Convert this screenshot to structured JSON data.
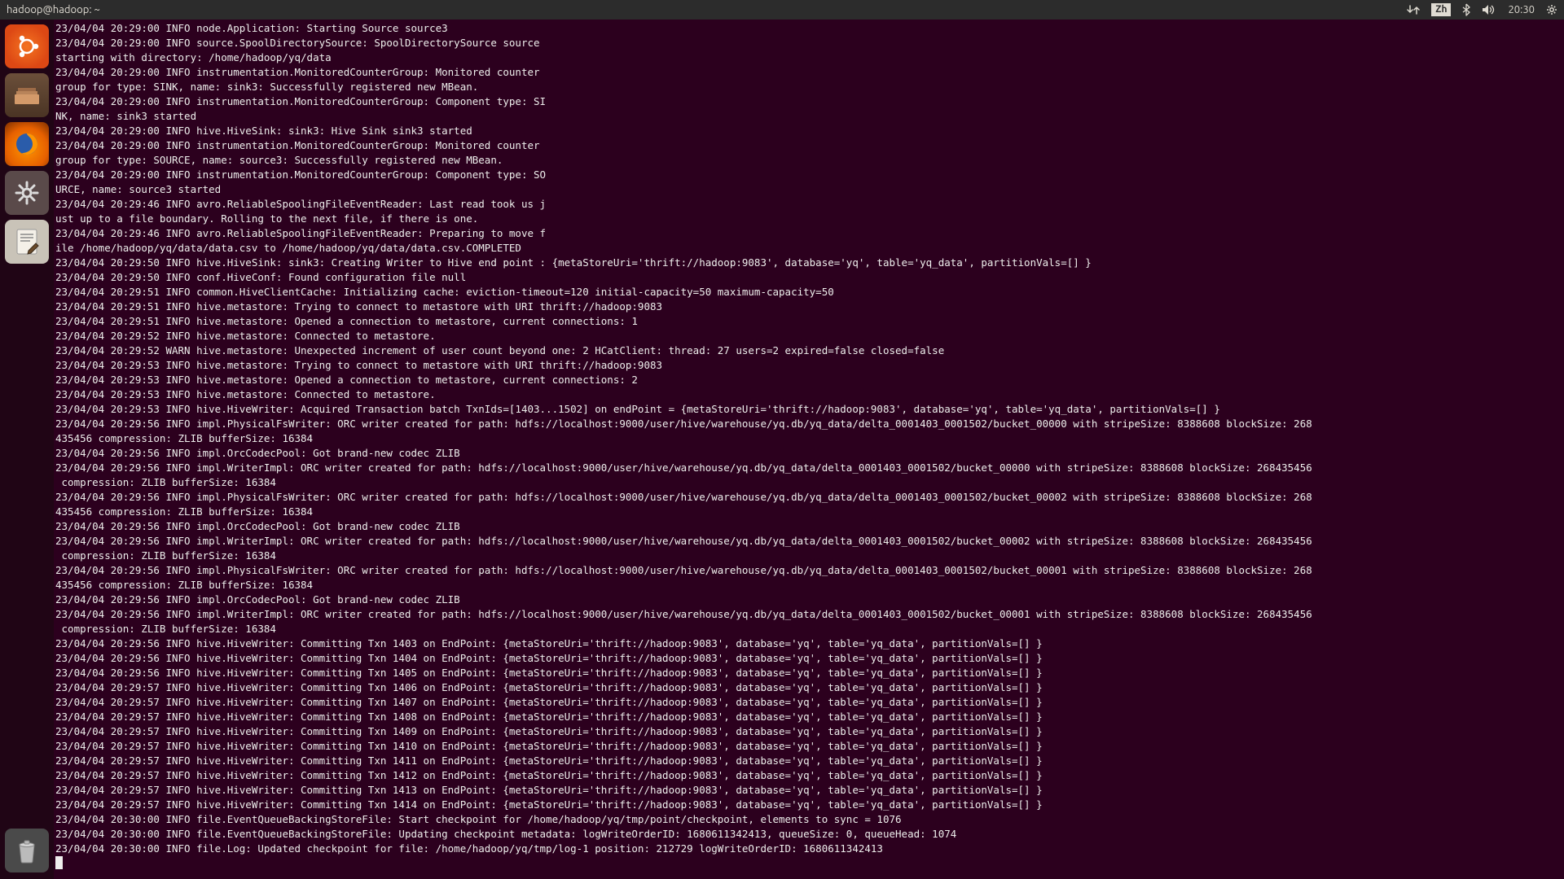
{
  "top_panel": {
    "window_title": "hadoop@hadoop: ~",
    "ime": "Zh",
    "time": "20:30"
  },
  "terminal": {
    "lines": [
      "23/04/04 20:29:00 INFO node.Application: Starting Source source3",
      "23/04/04 20:29:00 INFO source.SpoolDirectorySource: SpoolDirectorySource source",
      "starting with directory: /home/hadoop/yq/data",
      "23/04/04 20:29:00 INFO instrumentation.MonitoredCounterGroup: Monitored counter",
      "group for type: SINK, name: sink3: Successfully registered new MBean.",
      "23/04/04 20:29:00 INFO instrumentation.MonitoredCounterGroup: Component type: SI",
      "NK, name: sink3 started",
      "23/04/04 20:29:00 INFO hive.HiveSink: sink3: Hive Sink sink3 started",
      "23/04/04 20:29:00 INFO instrumentation.MonitoredCounterGroup: Monitored counter",
      "group for type: SOURCE, name: source3: Successfully registered new MBean.",
      "23/04/04 20:29:00 INFO instrumentation.MonitoredCounterGroup: Component type: SO",
      "URCE, name: source3 started",
      "23/04/04 20:29:46 INFO avro.ReliableSpoolingFileEventReader: Last read took us j",
      "ust up to a file boundary. Rolling to the next file, if there is one.",
      "23/04/04 20:29:46 INFO avro.ReliableSpoolingFileEventReader: Preparing to move f",
      "ile /home/hadoop/yq/data/data.csv to /home/hadoop/yq/data/data.csv.COMPLETED",
      "23/04/04 20:29:50 INFO hive.HiveSink: sink3: Creating Writer to Hive end point : {metaStoreUri='thrift://hadoop:9083', database='yq', table='yq_data', partitionVals=[] }",
      "23/04/04 20:29:50 INFO conf.HiveConf: Found configuration file null",
      "23/04/04 20:29:51 INFO common.HiveClientCache: Initializing cache: eviction-timeout=120 initial-capacity=50 maximum-capacity=50",
      "23/04/04 20:29:51 INFO hive.metastore: Trying to connect to metastore with URI thrift://hadoop:9083",
      "23/04/04 20:29:51 INFO hive.metastore: Opened a connection to metastore, current connections: 1",
      "23/04/04 20:29:52 INFO hive.metastore: Connected to metastore.",
      "23/04/04 20:29:52 WARN hive.metastore: Unexpected increment of user count beyond one: 2 HCatClient: thread: 27 users=2 expired=false closed=false",
      "23/04/04 20:29:53 INFO hive.metastore: Trying to connect to metastore with URI thrift://hadoop:9083",
      "23/04/04 20:29:53 INFO hive.metastore: Opened a connection to metastore, current connections: 2",
      "23/04/04 20:29:53 INFO hive.metastore: Connected to metastore.",
      "23/04/04 20:29:53 INFO hive.HiveWriter: Acquired Transaction batch TxnIds=[1403...1502] on endPoint = {metaStoreUri='thrift://hadoop:9083', database='yq', table='yq_data', partitionVals=[] }",
      "23/04/04 20:29:56 INFO impl.PhysicalFsWriter: ORC writer created for path: hdfs://localhost:9000/user/hive/warehouse/yq.db/yq_data/delta_0001403_0001502/bucket_00000 with stripeSize: 8388608 blockSize: 268",
      "435456 compression: ZLIB bufferSize: 16384",
      "23/04/04 20:29:56 INFO impl.OrcCodecPool: Got brand-new codec ZLIB",
      "23/04/04 20:29:56 INFO impl.WriterImpl: ORC writer created for path: hdfs://localhost:9000/user/hive/warehouse/yq.db/yq_data/delta_0001403_0001502/bucket_00000 with stripeSize: 8388608 blockSize: 268435456",
      " compression: ZLIB bufferSize: 16384",
      "23/04/04 20:29:56 INFO impl.PhysicalFsWriter: ORC writer created for path: hdfs://localhost:9000/user/hive/warehouse/yq.db/yq_data/delta_0001403_0001502/bucket_00002 with stripeSize: 8388608 blockSize: 268",
      "435456 compression: ZLIB bufferSize: 16384",
      "23/04/04 20:29:56 INFO impl.OrcCodecPool: Got brand-new codec ZLIB",
      "23/04/04 20:29:56 INFO impl.WriterImpl: ORC writer created for path: hdfs://localhost:9000/user/hive/warehouse/yq.db/yq_data/delta_0001403_0001502/bucket_00002 with stripeSize: 8388608 blockSize: 268435456",
      " compression: ZLIB bufferSize: 16384",
      "23/04/04 20:29:56 INFO impl.PhysicalFsWriter: ORC writer created for path: hdfs://localhost:9000/user/hive/warehouse/yq.db/yq_data/delta_0001403_0001502/bucket_00001 with stripeSize: 8388608 blockSize: 268",
      "435456 compression: ZLIB bufferSize: 16384",
      "23/04/04 20:29:56 INFO impl.OrcCodecPool: Got brand-new codec ZLIB",
      "23/04/04 20:29:56 INFO impl.WriterImpl: ORC writer created for path: hdfs://localhost:9000/user/hive/warehouse/yq.db/yq_data/delta_0001403_0001502/bucket_00001 with stripeSize: 8388608 blockSize: 268435456",
      " compression: ZLIB bufferSize: 16384",
      "23/04/04 20:29:56 INFO hive.HiveWriter: Committing Txn 1403 on EndPoint: {metaStoreUri='thrift://hadoop:9083', database='yq', table='yq_data', partitionVals=[] }",
      "23/04/04 20:29:56 INFO hive.HiveWriter: Committing Txn 1404 on EndPoint: {metaStoreUri='thrift://hadoop:9083', database='yq', table='yq_data', partitionVals=[] }",
      "23/04/04 20:29:56 INFO hive.HiveWriter: Committing Txn 1405 on EndPoint: {metaStoreUri='thrift://hadoop:9083', database='yq', table='yq_data', partitionVals=[] }",
      "23/04/04 20:29:57 INFO hive.HiveWriter: Committing Txn 1406 on EndPoint: {metaStoreUri='thrift://hadoop:9083', database='yq', table='yq_data', partitionVals=[] }",
      "23/04/04 20:29:57 INFO hive.HiveWriter: Committing Txn 1407 on EndPoint: {metaStoreUri='thrift://hadoop:9083', database='yq', table='yq_data', partitionVals=[] }",
      "23/04/04 20:29:57 INFO hive.HiveWriter: Committing Txn 1408 on EndPoint: {metaStoreUri='thrift://hadoop:9083', database='yq', table='yq_data', partitionVals=[] }",
      "23/04/04 20:29:57 INFO hive.HiveWriter: Committing Txn 1409 on EndPoint: {metaStoreUri='thrift://hadoop:9083', database='yq', table='yq_data', partitionVals=[] }",
      "23/04/04 20:29:57 INFO hive.HiveWriter: Committing Txn 1410 on EndPoint: {metaStoreUri='thrift://hadoop:9083', database='yq', table='yq_data', partitionVals=[] }",
      "23/04/04 20:29:57 INFO hive.HiveWriter: Committing Txn 1411 on EndPoint: {metaStoreUri='thrift://hadoop:9083', database='yq', table='yq_data', partitionVals=[] }",
      "23/04/04 20:29:57 INFO hive.HiveWriter: Committing Txn 1412 on EndPoint: {metaStoreUri='thrift://hadoop:9083', database='yq', table='yq_data', partitionVals=[] }",
      "23/04/04 20:29:57 INFO hive.HiveWriter: Committing Txn 1413 on EndPoint: {metaStoreUri='thrift://hadoop:9083', database='yq', table='yq_data', partitionVals=[] }",
      "23/04/04 20:29:57 INFO hive.HiveWriter: Committing Txn 1414 on EndPoint: {metaStoreUri='thrift://hadoop:9083', database='yq', table='yq_data', partitionVals=[] }",
      "23/04/04 20:30:00 INFO file.EventQueueBackingStoreFile: Start checkpoint for /home/hadoop/yq/tmp/point/checkpoint, elements to sync = 1076",
      "23/04/04 20:30:00 INFO file.EventQueueBackingStoreFile: Updating checkpoint metadata: logWriteOrderID: 1680611342413, queueSize: 0, queueHead: 1074",
      "23/04/04 20:30:00 INFO file.Log: Updated checkpoint for file: /home/hadoop/yq/tmp/log-1 position: 212729 logWriteOrderID: 1680611342413"
    ]
  }
}
